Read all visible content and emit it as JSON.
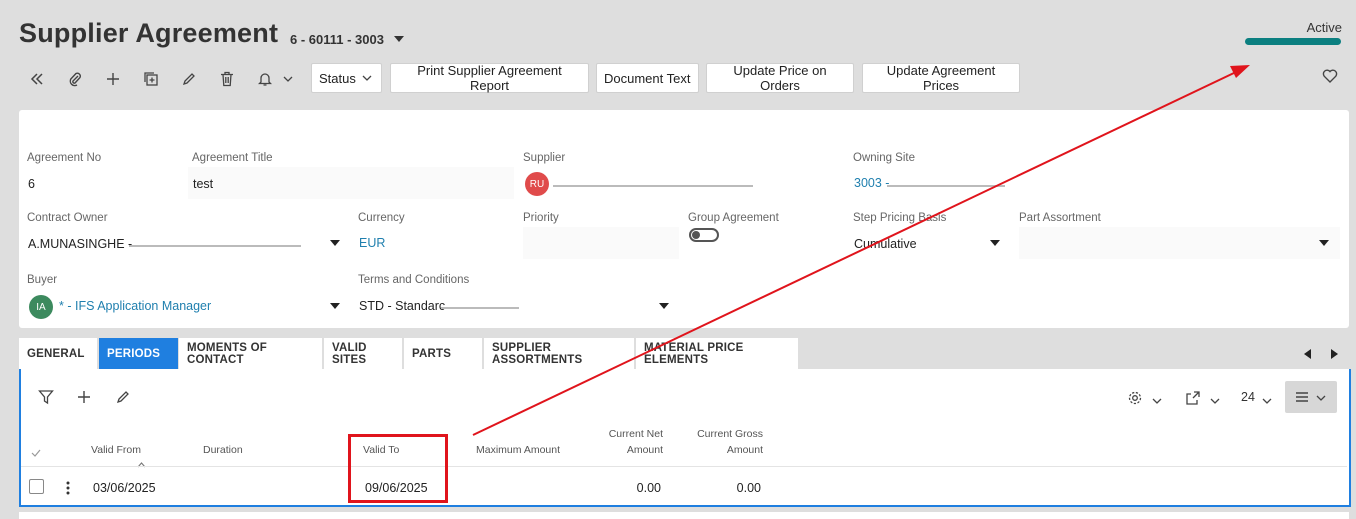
{
  "header": {
    "title": "Supplier Agreement",
    "reference": "6 - 60111 - 3003",
    "status": "Active",
    "status_color": "#0b7f80"
  },
  "toolbar": {
    "icons": [
      "collapse-left-icon",
      "paperclip-icon",
      "plus-icon",
      "duplicate-icon",
      "pencil-icon",
      "trash-icon",
      "bell-icon"
    ],
    "status_label": "Status",
    "buttons": [
      "Print Supplier Agreement Report",
      "Document Text",
      "Update Price on Orders",
      "Update Agreement Prices"
    ]
  },
  "form": {
    "agreement_no": {
      "label": "Agreement No",
      "value": "6"
    },
    "agreement_title": {
      "label": "Agreement Title",
      "value": "test"
    },
    "supplier": {
      "label": "Supplier",
      "avatar": "RU",
      "avatar_color": "#e04b4b"
    },
    "owning_site": {
      "label": "Owning Site",
      "value": "3003 -"
    },
    "contract_owner": {
      "label": "Contract Owner",
      "value": "A.MUNASINGHE -"
    },
    "currency": {
      "label": "Currency",
      "value": "EUR"
    },
    "priority": {
      "label": "Priority",
      "value": ""
    },
    "group_agreement": {
      "label": "Group Agreement",
      "value": false
    },
    "step_pricing_basis": {
      "label": "Step Pricing Basis",
      "value": "Cumulative"
    },
    "part_assortment": {
      "label": "Part Assortment",
      "value": ""
    },
    "buyer": {
      "label": "Buyer",
      "avatar": "IA",
      "avatar_color": "#3c8a5e",
      "value": "* - IFS Application Manager"
    },
    "terms": {
      "label": "Terms and Conditions",
      "value": "STD - Standarc"
    }
  },
  "tabs": [
    "GENERAL",
    "PERIODS",
    "MOMENTS OF CONTACT",
    "VALID SITES",
    "PARTS",
    "SUPPLIER ASSORTMENTS",
    "MATERIAL PRICE ELEMENTS"
  ],
  "active_tab": "PERIODS",
  "grid": {
    "page_size": "24",
    "columns": {
      "valid_from": "Valid From",
      "duration": "Duration",
      "valid_to": "Valid To",
      "maximum_amount": "Maximum Amount",
      "current_net_amount_1": "Current Net",
      "current_net_amount_2": "Amount",
      "current_gross_amount_1": "Current Gross",
      "current_gross_amount_2": "Amount"
    },
    "rows": [
      {
        "valid_from": "03/06/2025",
        "duration": "",
        "valid_to": "09/06/2025",
        "maximum_amount": "",
        "current_net_amount": "0.00",
        "current_gross_amount": "0.00"
      }
    ]
  },
  "annotation_color": "#e0141c"
}
